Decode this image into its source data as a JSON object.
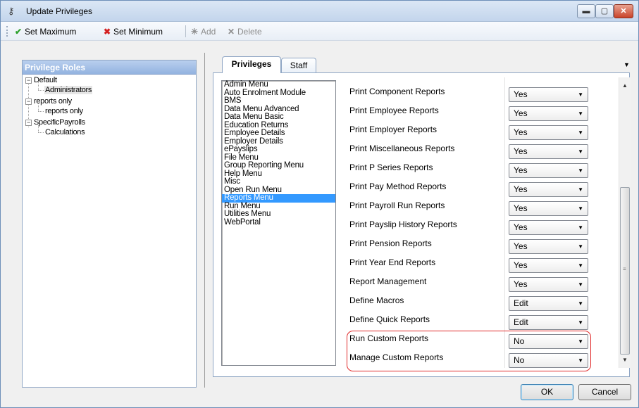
{
  "window": {
    "title": "Update Privileges",
    "title_icon": "key-icon",
    "controls": {
      "minimize": "▬",
      "maximize": "▢",
      "close": "✕"
    }
  },
  "toolbar": {
    "set_maximum": "Set Maximum",
    "set_minimum": "Set Minimum",
    "add": "Add",
    "delete": "Delete",
    "icons": {
      "set_maximum": "green-check-icon",
      "set_minimum": "red-cross-icon",
      "add": "add-icon",
      "delete": "delete-icon"
    }
  },
  "roles_panel": {
    "header": "Privilege Roles",
    "tree": [
      {
        "label": "Default",
        "children": [
          "Administrators"
        ]
      },
      {
        "label": "reports only",
        "children": [
          "reports only"
        ]
      },
      {
        "label": "SpecificPayrolls",
        "children": [
          "Calculations"
        ]
      }
    ]
  },
  "tabs": [
    {
      "label": "Privileges",
      "active": true
    },
    {
      "label": "Staff",
      "active": false
    }
  ],
  "menu_list": {
    "items": [
      "Admin Menu",
      "Auto Enrolment Module",
      "BMS",
      "Data Menu Advanced",
      "Data Menu Basic",
      "Education Returns",
      "Employee Details",
      "Employer Details",
      "ePayslips",
      "File Menu",
      "Group Reporting Menu",
      "Help Menu",
      "Misc",
      "Open Run Menu",
      "Reports Menu",
      "Run Menu",
      "Utilities Menu",
      "WebPortal"
    ],
    "selected": "Reports Menu"
  },
  "privileges": [
    {
      "label": "Print Component Reports",
      "value": "Yes"
    },
    {
      "label": "Print Employee Reports",
      "value": "Yes"
    },
    {
      "label": "Print Employer Reports",
      "value": "Yes"
    },
    {
      "label": "Print Miscellaneous Reports",
      "value": "Yes"
    },
    {
      "label": "Print P Series Reports",
      "value": "Yes"
    },
    {
      "label": "Print Pay Method Reports",
      "value": "Yes"
    },
    {
      "label": "Print Payroll Run Reports",
      "value": "Yes"
    },
    {
      "label": "Print Payslip History Reports",
      "value": "Yes"
    },
    {
      "label": "Print Pension Reports",
      "value": "Yes"
    },
    {
      "label": "Print Year End Reports",
      "value": "Yes"
    },
    {
      "label": "Report Management",
      "value": "Yes"
    },
    {
      "label": "Define Macros",
      "value": "Edit"
    },
    {
      "label": "Define Quick Reports",
      "value": "Edit"
    },
    {
      "label": "Run Custom Reports",
      "value": "No"
    },
    {
      "label": "Manage Custom Reports",
      "value": "No"
    }
  ],
  "buttons": {
    "ok": "OK",
    "cancel": "Cancel"
  },
  "colors": {
    "highlight": "#e02a2a",
    "selection": "#3399ff",
    "panel_header": "#93b3e0"
  }
}
